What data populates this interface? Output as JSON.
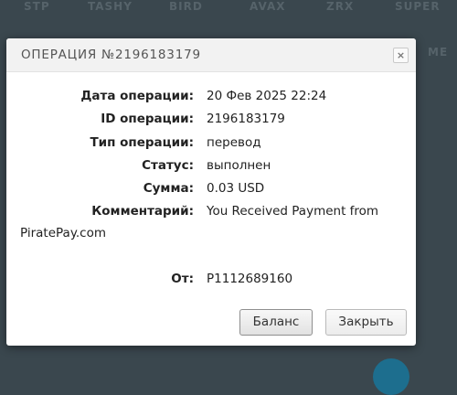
{
  "background": {
    "tabs": [
      "STP",
      "TASHY",
      "BIRD",
      "AVAX",
      "ZRX",
      "SUPER"
    ],
    "more_label": "МЕ"
  },
  "modal": {
    "title": "ОПЕРАЦИЯ №2196183179",
    "close_icon": "×",
    "fields": {
      "date": {
        "label": "Дата операции:",
        "value": "20 Фев 2025 22:24"
      },
      "id": {
        "label": "ID операции:",
        "value": "2196183179"
      },
      "type": {
        "label": "Тип операции:",
        "value": "перевод"
      },
      "status": {
        "label": "Статус:",
        "value": "выполнен"
      },
      "amount": {
        "label": "Сумма:",
        "value": "0.03 USD"
      },
      "comment": {
        "label": "Комментарий:",
        "value": "You Received Payment from",
        "value_cont": "PiratePay.com"
      },
      "from": {
        "label": "От:",
        "value": "P1112689160"
      }
    },
    "buttons": {
      "balance": "Баланс",
      "close": "Закрыть"
    }
  },
  "colors": {
    "backdrop": "#3a474e",
    "header_bg": "#f2f2f2",
    "accent_circle": "#1d6e8e"
  }
}
